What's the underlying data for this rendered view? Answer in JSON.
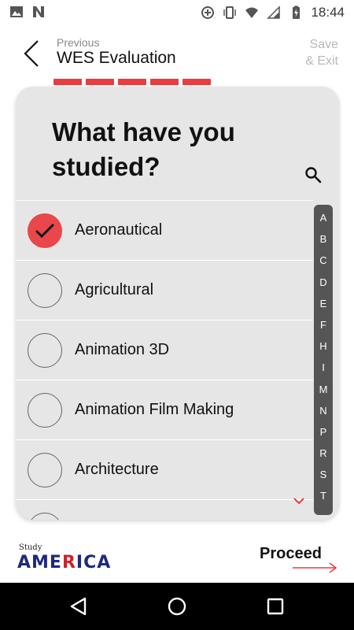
{
  "status_bar": {
    "time": "18:44",
    "icons_left": [
      "image-icon",
      "n-notification-icon"
    ],
    "icons_right": [
      "data-saver-icon",
      "vibrate-icon",
      "wifi-icon",
      "cellular-signal-icon",
      "battery-charging-icon"
    ]
  },
  "header": {
    "previous_label": "Previous",
    "title": "WES Evaluation",
    "save_exit_line1": "Save",
    "save_exit_line2": "& Exit"
  },
  "progress": {
    "segments": 5,
    "color": "#ea3b3f"
  },
  "question": {
    "text": "What have you studied?"
  },
  "options": [
    {
      "label": "Aeronautical",
      "checked": true
    },
    {
      "label": "Agricultural",
      "checked": false
    },
    {
      "label": "Animation 3D",
      "checked": false
    },
    {
      "label": "Animation Film Making",
      "checked": false
    },
    {
      "label": "Architecture",
      "checked": false
    }
  ],
  "alphabet_index": [
    "A",
    "B",
    "C",
    "D",
    "E",
    "F",
    "H",
    "I",
    "M",
    "N",
    "P",
    "R",
    "S",
    "T"
  ],
  "footer": {
    "logo_small": "Study",
    "logo_main_blue": "AME",
    "logo_main_red": "R",
    "logo_main_blue2": "ICA",
    "proceed_label": "Proceed"
  },
  "colors": {
    "accent": "#ea3b3f",
    "card_bg": "#e6e6e6",
    "index_bar": "#555555"
  }
}
